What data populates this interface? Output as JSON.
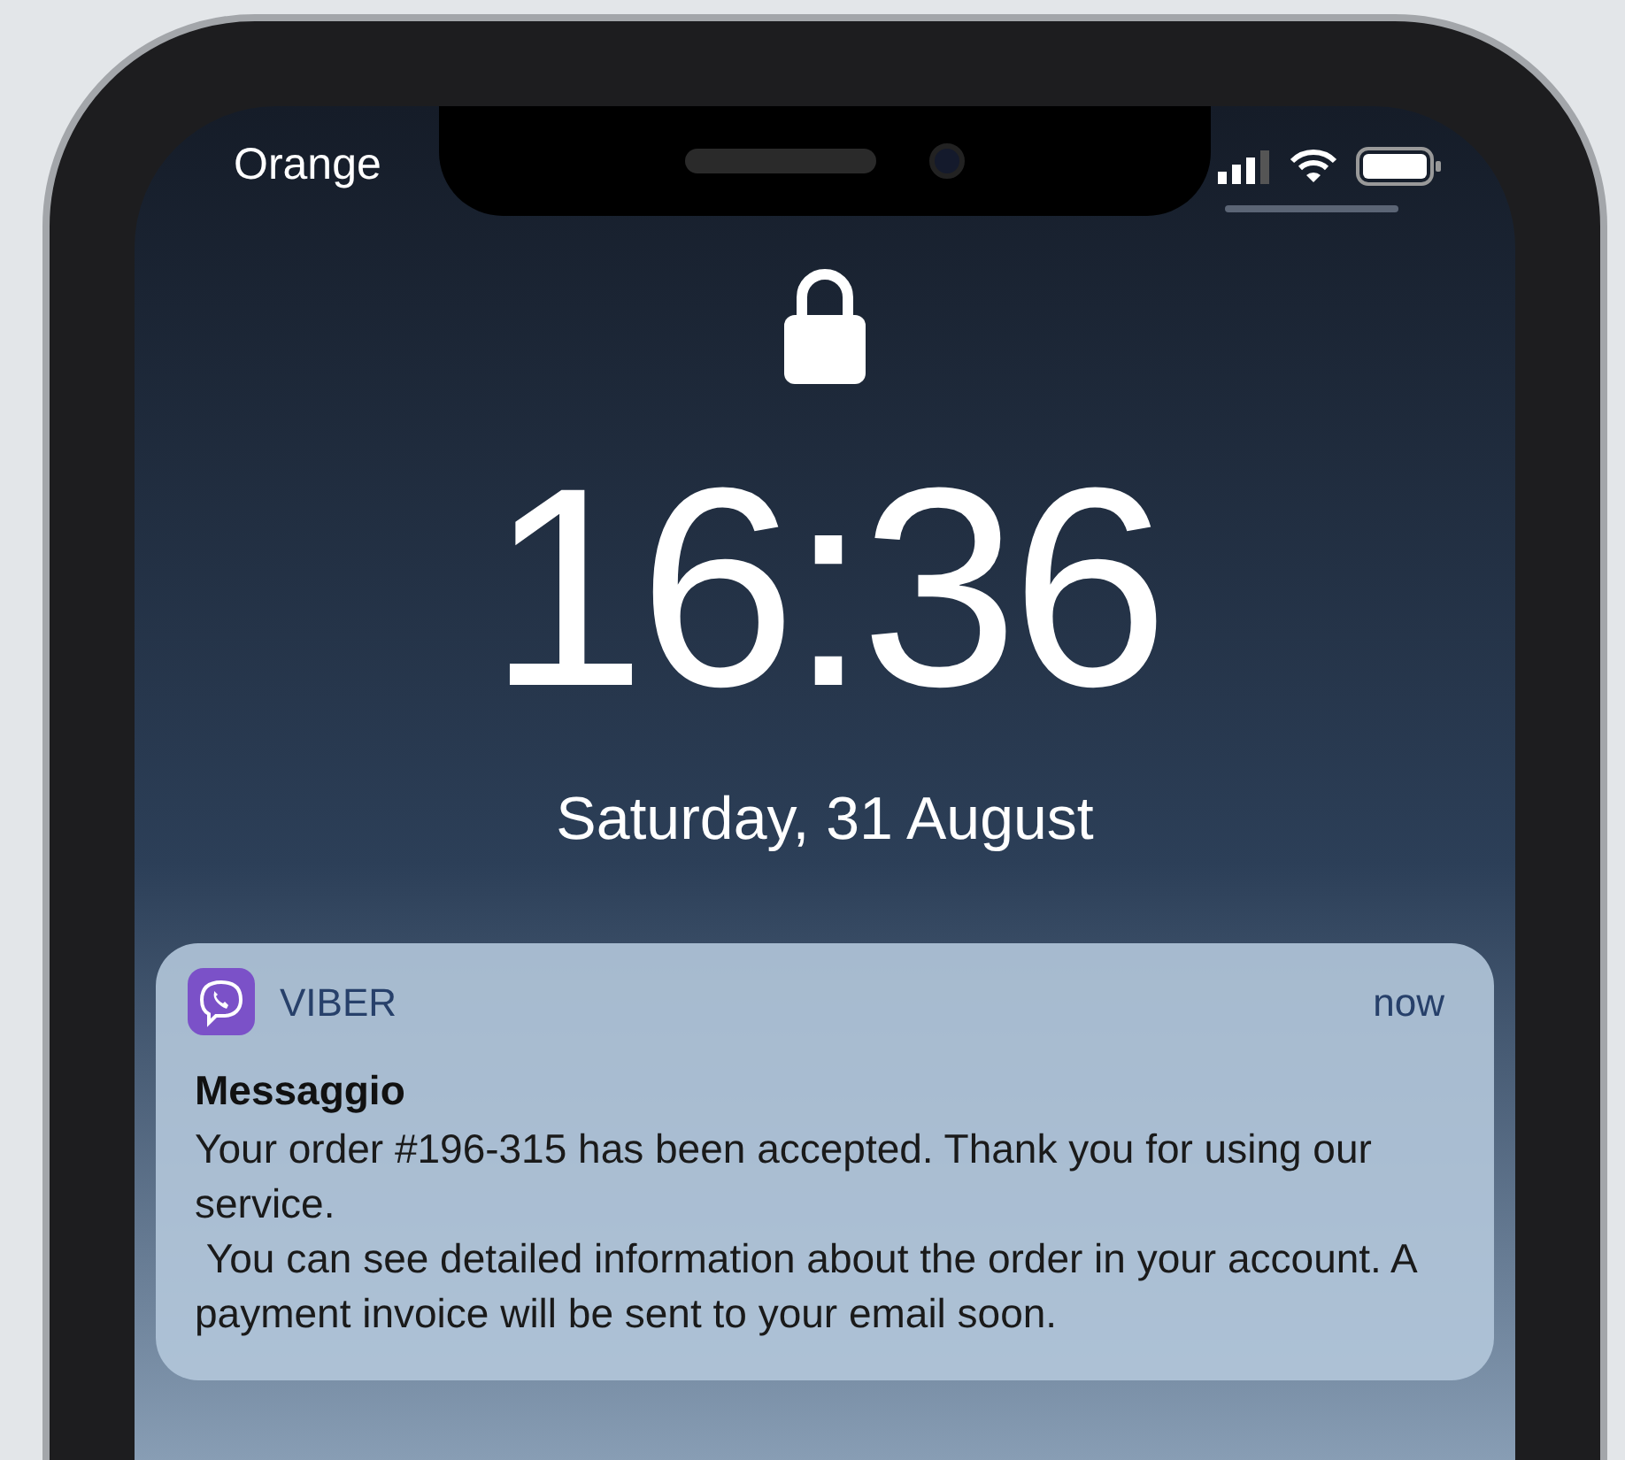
{
  "status_bar": {
    "carrier": "Orange"
  },
  "lock_screen": {
    "time": "16:36",
    "date": "Saturday, 31 August"
  },
  "notification": {
    "app": "VIBER",
    "time": "now",
    "title": "Messaggio",
    "body": "Your order #196-315 has been accepted. Thank you for using our service.\n You can see detailed information about the order in your account. A payment invoice will be sent to your email soon."
  }
}
